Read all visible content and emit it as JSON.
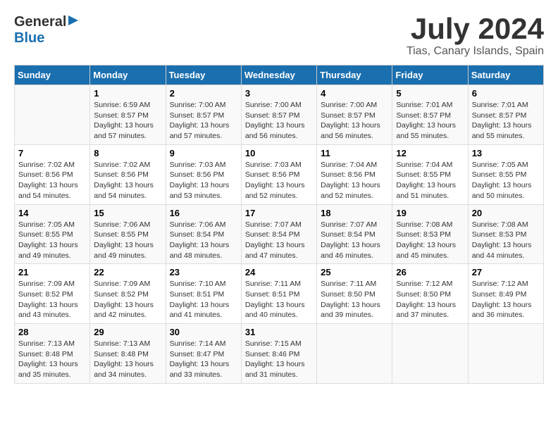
{
  "header": {
    "logo_general": "General",
    "logo_blue": "Blue",
    "month_title": "July 2024",
    "location": "Tias, Canary Islands, Spain"
  },
  "columns": [
    "Sunday",
    "Monday",
    "Tuesday",
    "Wednesday",
    "Thursday",
    "Friday",
    "Saturday"
  ],
  "weeks": [
    {
      "days": [
        {
          "num": "",
          "info": ""
        },
        {
          "num": "1",
          "info": "Sunrise: 6:59 AM\nSunset: 8:57 PM\nDaylight: 13 hours\nand 57 minutes."
        },
        {
          "num": "2",
          "info": "Sunrise: 7:00 AM\nSunset: 8:57 PM\nDaylight: 13 hours\nand 57 minutes."
        },
        {
          "num": "3",
          "info": "Sunrise: 7:00 AM\nSunset: 8:57 PM\nDaylight: 13 hours\nand 56 minutes."
        },
        {
          "num": "4",
          "info": "Sunrise: 7:00 AM\nSunset: 8:57 PM\nDaylight: 13 hours\nand 56 minutes."
        },
        {
          "num": "5",
          "info": "Sunrise: 7:01 AM\nSunset: 8:57 PM\nDaylight: 13 hours\nand 55 minutes."
        },
        {
          "num": "6",
          "info": "Sunrise: 7:01 AM\nSunset: 8:57 PM\nDaylight: 13 hours\nand 55 minutes."
        }
      ]
    },
    {
      "days": [
        {
          "num": "7",
          "info": "Sunrise: 7:02 AM\nSunset: 8:56 PM\nDaylight: 13 hours\nand 54 minutes."
        },
        {
          "num": "8",
          "info": "Sunrise: 7:02 AM\nSunset: 8:56 PM\nDaylight: 13 hours\nand 54 minutes."
        },
        {
          "num": "9",
          "info": "Sunrise: 7:03 AM\nSunset: 8:56 PM\nDaylight: 13 hours\nand 53 minutes."
        },
        {
          "num": "10",
          "info": "Sunrise: 7:03 AM\nSunset: 8:56 PM\nDaylight: 13 hours\nand 52 minutes."
        },
        {
          "num": "11",
          "info": "Sunrise: 7:04 AM\nSunset: 8:56 PM\nDaylight: 13 hours\nand 52 minutes."
        },
        {
          "num": "12",
          "info": "Sunrise: 7:04 AM\nSunset: 8:55 PM\nDaylight: 13 hours\nand 51 minutes."
        },
        {
          "num": "13",
          "info": "Sunrise: 7:05 AM\nSunset: 8:55 PM\nDaylight: 13 hours\nand 50 minutes."
        }
      ]
    },
    {
      "days": [
        {
          "num": "14",
          "info": "Sunrise: 7:05 AM\nSunset: 8:55 PM\nDaylight: 13 hours\nand 49 minutes."
        },
        {
          "num": "15",
          "info": "Sunrise: 7:06 AM\nSunset: 8:55 PM\nDaylight: 13 hours\nand 49 minutes."
        },
        {
          "num": "16",
          "info": "Sunrise: 7:06 AM\nSunset: 8:54 PM\nDaylight: 13 hours\nand 48 minutes."
        },
        {
          "num": "17",
          "info": "Sunrise: 7:07 AM\nSunset: 8:54 PM\nDaylight: 13 hours\nand 47 minutes."
        },
        {
          "num": "18",
          "info": "Sunrise: 7:07 AM\nSunset: 8:54 PM\nDaylight: 13 hours\nand 46 minutes."
        },
        {
          "num": "19",
          "info": "Sunrise: 7:08 AM\nSunset: 8:53 PM\nDaylight: 13 hours\nand 45 minutes."
        },
        {
          "num": "20",
          "info": "Sunrise: 7:08 AM\nSunset: 8:53 PM\nDaylight: 13 hours\nand 44 minutes."
        }
      ]
    },
    {
      "days": [
        {
          "num": "21",
          "info": "Sunrise: 7:09 AM\nSunset: 8:52 PM\nDaylight: 13 hours\nand 43 minutes."
        },
        {
          "num": "22",
          "info": "Sunrise: 7:09 AM\nSunset: 8:52 PM\nDaylight: 13 hours\nand 42 minutes."
        },
        {
          "num": "23",
          "info": "Sunrise: 7:10 AM\nSunset: 8:51 PM\nDaylight: 13 hours\nand 41 minutes."
        },
        {
          "num": "24",
          "info": "Sunrise: 7:11 AM\nSunset: 8:51 PM\nDaylight: 13 hours\nand 40 minutes."
        },
        {
          "num": "25",
          "info": "Sunrise: 7:11 AM\nSunset: 8:50 PM\nDaylight: 13 hours\nand 39 minutes."
        },
        {
          "num": "26",
          "info": "Sunrise: 7:12 AM\nSunset: 8:50 PM\nDaylight: 13 hours\nand 37 minutes."
        },
        {
          "num": "27",
          "info": "Sunrise: 7:12 AM\nSunset: 8:49 PM\nDaylight: 13 hours\nand 36 minutes."
        }
      ]
    },
    {
      "days": [
        {
          "num": "28",
          "info": "Sunrise: 7:13 AM\nSunset: 8:48 PM\nDaylight: 13 hours\nand 35 minutes."
        },
        {
          "num": "29",
          "info": "Sunrise: 7:13 AM\nSunset: 8:48 PM\nDaylight: 13 hours\nand 34 minutes."
        },
        {
          "num": "30",
          "info": "Sunrise: 7:14 AM\nSunset: 8:47 PM\nDaylight: 13 hours\nand 33 minutes."
        },
        {
          "num": "31",
          "info": "Sunrise: 7:15 AM\nSunset: 8:46 PM\nDaylight: 13 hours\nand 31 minutes."
        },
        {
          "num": "",
          "info": ""
        },
        {
          "num": "",
          "info": ""
        },
        {
          "num": "",
          "info": ""
        }
      ]
    }
  ]
}
